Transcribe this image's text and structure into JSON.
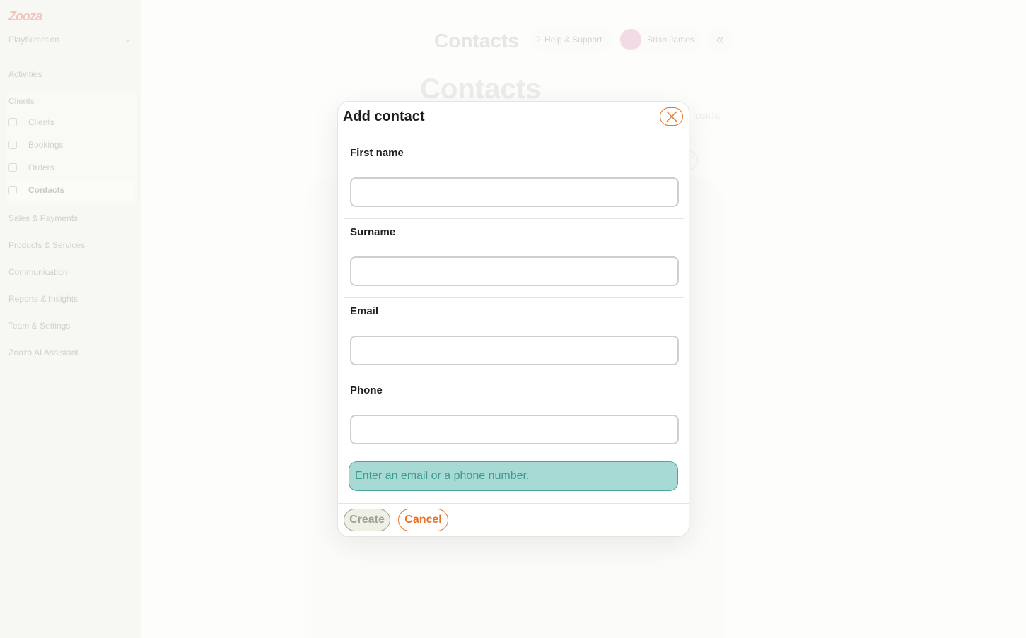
{
  "app": {
    "logo_text": "Zooza",
    "org_name": "Playfulmotion"
  },
  "sidebar": {
    "activities": "Activities",
    "clients_group": "Clients",
    "sub_items": [
      {
        "label": "Clients",
        "icon": "clients-icon"
      },
      {
        "label": "Bookings",
        "icon": "bookings-icon"
      },
      {
        "label": "Orders",
        "icon": "orders-icon"
      },
      {
        "label": "Contacts",
        "icon": "contacts-icon",
        "active": true
      }
    ],
    "sales": "Sales & Payments",
    "products": "Products & Services",
    "communication": "Communication",
    "reports": "Reports & Insights",
    "team": "Team & Settings",
    "ai": "Zooza AI Assistant"
  },
  "header": {
    "title": "Contacts",
    "help": "Help & Support",
    "help_icon": "?",
    "user_name": "Brian James",
    "collapse_icon": "«"
  },
  "page": {
    "heading": "Contacts",
    "bg_text_1": "loads",
    "bg_text_2": "."
  },
  "modal": {
    "title": "Add contact",
    "fields": [
      {
        "label": "First name",
        "value": "",
        "placeholder": ""
      },
      {
        "label": "Surname",
        "value": "",
        "placeholder": ""
      },
      {
        "label": "Email",
        "value": "",
        "placeholder": ""
      },
      {
        "label": "Phone",
        "value": "",
        "placeholder": ""
      }
    ],
    "hint": "Enter an email or a phone number.",
    "create_label": "Create",
    "cancel_label": "Cancel"
  },
  "colors": {
    "accent": "#e8722a",
    "hint_bg": "#a8dad5",
    "hint_text": "#3f9a91"
  }
}
